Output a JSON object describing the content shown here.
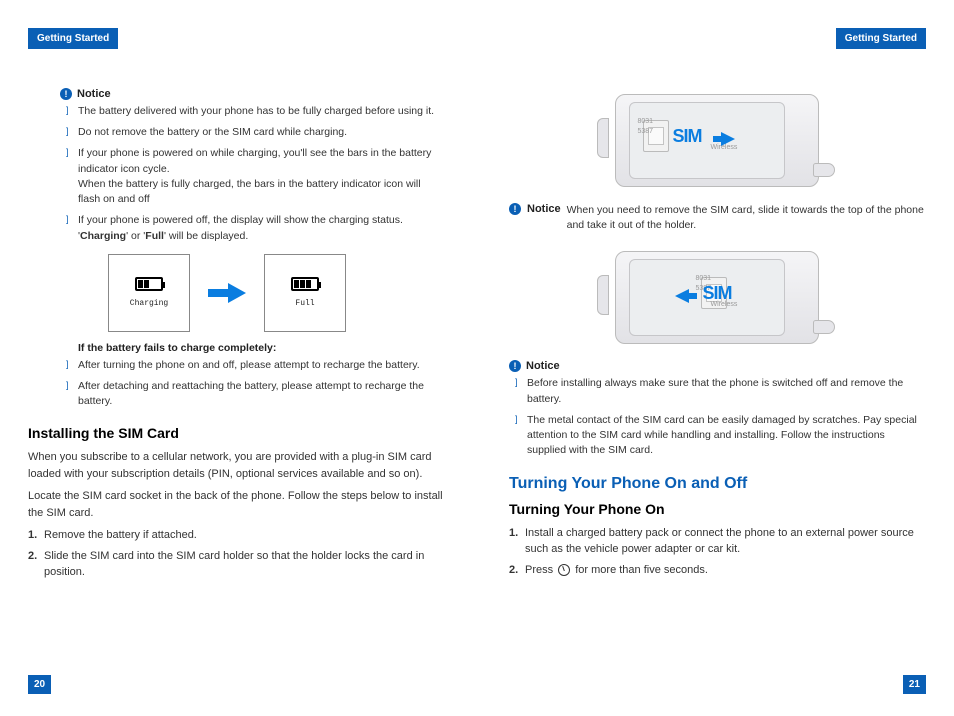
{
  "header": {
    "left": "Getting Started",
    "right": "Getting Started"
  },
  "pagenum": {
    "left": "20",
    "right": "21"
  },
  "notice_label": "Notice",
  "left": {
    "notice1": {
      "items": [
        "The battery delivered with your phone has to be fully charged before using it.",
        "Do not remove the battery or the SIM card while charging.",
        "If your phone is powered on while charging, you'll see the bars in the battery indicator icon cycle.\nWhen the battery is fully charged, the bars in the battery indicator icon will flash on and off",
        "If your phone is powered off, the display will show the charging status. 'Charging' or 'Full' will be displayed."
      ]
    },
    "charge": {
      "charging": "Charging",
      "full": "Full"
    },
    "fail_heading": "If the battery fails to charge completely:",
    "fail_items": [
      "After turning the phone on and off, please attempt to recharge the battery.",
      "After detaching and reattaching the battery, please attempt to recharge the battery."
    ],
    "sim_heading": "Installing the SIM Card",
    "sim_p1": "When you subscribe to a cellular network, you are provided with a plug-in SIM card loaded with your subscription details (PIN, optional services available and so on).",
    "sim_p2": "Locate the SIM card socket in the back of the phone. Follow the steps below to install the SIM card.",
    "sim_steps": [
      "Remove the battery if attached.",
      "Slide the SIM card into the SIM card holder so that the holder locks the card in position."
    ]
  },
  "right": {
    "sim_label": "SIM",
    "wireless_label": "Wireless",
    "code_a": "8031",
    "code_b": "5387",
    "notice_inline": "When you need to remove the SIM card, slide it towards the top of the phone and take it out of the holder.",
    "notice2_items": [
      "Before installing always make sure that the phone is switched off and remove the battery.",
      "The metal contact of the SIM card can be easily damaged by scratches. Pay special attention to the SIM card while handling and installing. Follow the instructions supplied with the SIM card."
    ],
    "turn_heading": "Turning Your Phone On and Off",
    "turn_on_heading": "Turning Your Phone On",
    "turn_on_steps": [
      "Install a charged battery pack or connect the phone to an external power source such as the vehicle power adapter or car kit.",
      "Press  for more than five seconds."
    ],
    "step2_prefix": "Press ",
    "step2_suffix": " for more than five seconds."
  },
  "inline_bold": {
    "charging": "Charging",
    "full": "Full"
  }
}
